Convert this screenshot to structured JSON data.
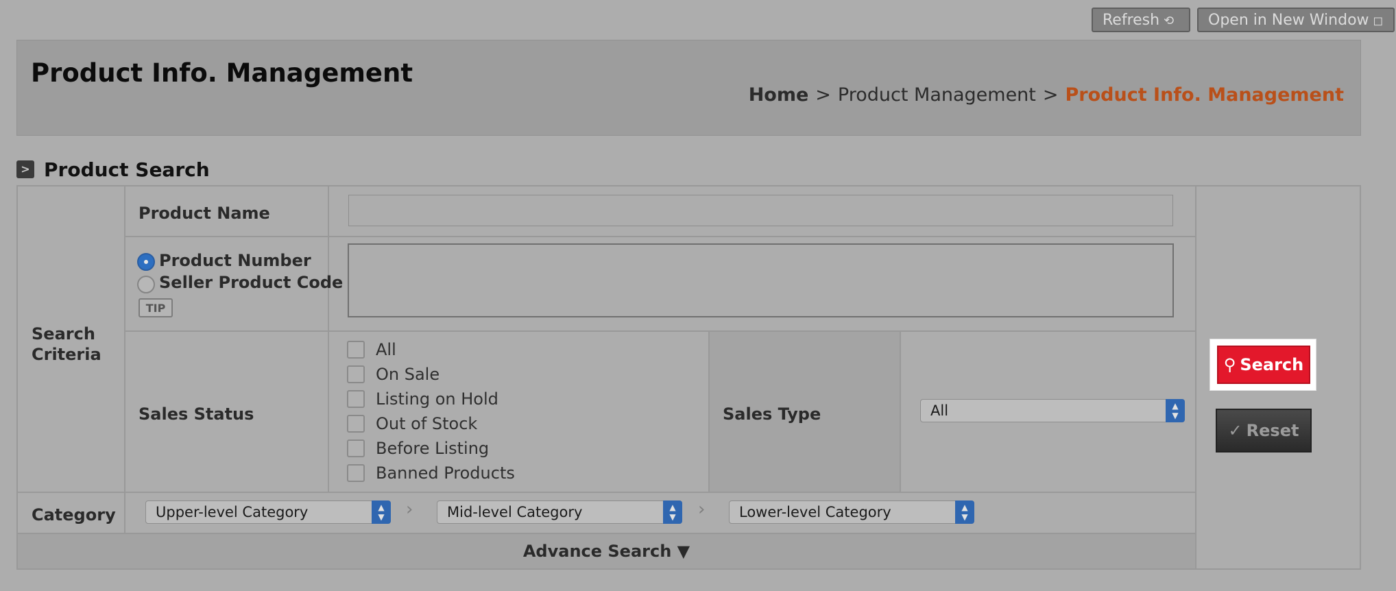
{
  "toolbar": {
    "refresh_label": "Refresh",
    "new_window_label": "Open in New Window"
  },
  "header": {
    "title": "Product Info. Management",
    "breadcrumb": {
      "home": "Home",
      "separator": ">",
      "middle": "Product Management",
      "current": "Product Info. Management"
    }
  },
  "section": {
    "title": "Product Search"
  },
  "form": {
    "search_criteria_label": "Search Criteria",
    "product_name_label": "Product Name",
    "product_name_value": "",
    "product_number_option": "Product Number",
    "seller_code_option": "Seller Product Code",
    "selected_option": "Product Number",
    "tip_label": "TIP",
    "sales_status_label": "Sales Status",
    "sales_status_options": [
      "All",
      "On Sale",
      "Listing on Hold",
      "Out of Stock",
      "Before Listing",
      "Banned Products"
    ],
    "sales_type_label": "Sales Type",
    "sales_type_value": "All",
    "category_label": "Category",
    "category_upper": "Upper-level Category",
    "category_mid": "Mid-level Category",
    "category_lower": "Lower-level Category",
    "advance_search_label": "Advance Search ▼"
  },
  "actions": {
    "search_label": "Search",
    "reset_label": "Reset"
  },
  "colors": {
    "background": "#adadad",
    "breadcrumb_current": "#b9501a",
    "search_button": "#e3182b",
    "select_accent": "#2f66b0"
  }
}
